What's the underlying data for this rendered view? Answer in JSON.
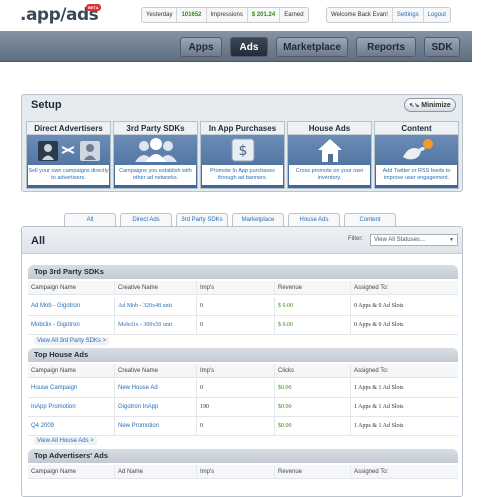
{
  "brand": {
    "logo": ".app/ads",
    "badge": "BETA"
  },
  "stats": {
    "yesterday": "Yesterday",
    "impressions_value": "101652",
    "impressions_label": "Impressions",
    "earned_value": "$ 201.24",
    "earned_label": "Earned"
  },
  "account": {
    "welcome": "Welcome Back Evan!",
    "settings": "Settings",
    "logout": "Logout"
  },
  "nav": {
    "items": [
      "Apps",
      "Ads",
      "Marketplace",
      "Reports",
      "SDK"
    ],
    "active": "Ads"
  },
  "setup": {
    "title": "Setup",
    "minimize": "Minimize",
    "cards": [
      {
        "title": "Direct Advertisers",
        "desc": "Sell your own campaigns directly to advertisers.",
        "icon": "people-exchange-icon"
      },
      {
        "title": "3rd Party SDKs",
        "desc": "Campaigns you establish with other ad networks.",
        "icon": "group-icon"
      },
      {
        "title": "In App Purchases",
        "desc": "Promote In App purchases through ad banners.",
        "icon": "coins-icon"
      },
      {
        "title": "House Ads",
        "desc": "Cross promote on your own inventory.",
        "icon": "house-icon"
      },
      {
        "title": "Content",
        "desc": "Add Twitter or RSS feeds to improve user engagement.",
        "icon": "bird-rss-icon"
      }
    ]
  },
  "tabs": [
    "All",
    "Direct Ads",
    "3rd Party SDKs",
    "Marketplace",
    "House Ads",
    "Content"
  ],
  "panel": {
    "title": "All",
    "filter_label": "Filter:",
    "filter_value": "View All Statuses..."
  },
  "sections": {
    "sdk": {
      "title": "Top 3rd Party SDKs",
      "headers": [
        "Campaign Name",
        "Creative Name",
        "Imp's",
        "Revenue",
        "Assigned To:"
      ],
      "rows": [
        [
          "Ad Mob - Gigotron",
          "Ad Mob - 320x48 unit",
          "0",
          "$ 0.00",
          "0 Apps & 0 Ad Slots"
        ],
        [
          "Mobclix - Gigotron",
          "Mobclix - 300x50 unit",
          "0",
          "$ 0.00",
          "0 Apps & 0 Ad Slots"
        ]
      ],
      "view_all": "View All 3rd Party SDKs >"
    },
    "house": {
      "title": "Top House Ads",
      "headers": [
        "Campaign Name",
        "Creative Name",
        "Imp's",
        "Clicks",
        "Assigned To:"
      ],
      "rows": [
        [
          "House Campaign",
          "New House Ad",
          "0",
          "$0.00",
          "1 Apps & 1 Ad Slots"
        ],
        [
          "InApp Promotion",
          "Gigotron InApp",
          "190",
          "$0.00",
          "1 Apps & 1 Ad Slots"
        ],
        [
          "Q4 2009",
          "New Promotion",
          "0",
          "$0.00",
          "1 Apps & 1 Ad Slots"
        ]
      ],
      "view_all": "View All House Ads >"
    },
    "advertisers": {
      "title": "Top Advertisers' Ads",
      "headers": [
        "Campaign Name",
        "Ad Name",
        "Imp's",
        "Revenue",
        "Assigned To:"
      ]
    }
  }
}
